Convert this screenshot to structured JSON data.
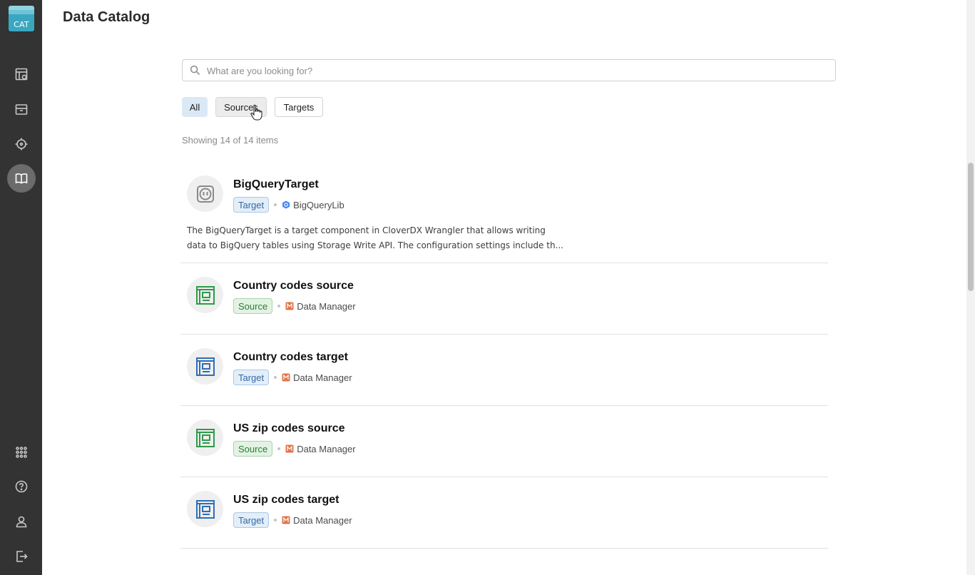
{
  "app": {
    "logo_text": "CAT"
  },
  "sidebar": {
    "items": [
      {
        "name": "sidebar-item-tables",
        "icon": "table-icon",
        "active": false
      },
      {
        "name": "sidebar-item-files",
        "icon": "folder-icon",
        "active": false
      },
      {
        "name": "sidebar-item-target",
        "icon": "crosshair-icon",
        "active": false
      },
      {
        "name": "sidebar-item-catalog",
        "icon": "book-icon",
        "active": true
      }
    ],
    "bottom_items": [
      {
        "name": "sidebar-item-apps",
        "icon": "grid-icon"
      },
      {
        "name": "sidebar-item-help",
        "icon": "help-icon"
      },
      {
        "name": "sidebar-item-profile",
        "icon": "user-icon"
      },
      {
        "name": "sidebar-item-logout",
        "icon": "logout-icon"
      }
    ]
  },
  "header": {
    "title": "Data Catalog"
  },
  "search": {
    "placeholder": "What are you looking for?",
    "value": ""
  },
  "filters": {
    "all": "All",
    "sources": "Sources",
    "targets": "Targets",
    "selected": "All"
  },
  "results": {
    "count_text": "Showing 14 of 14 items"
  },
  "items": [
    {
      "title": "BigQueryTarget",
      "tag": "Target",
      "library": "BigQueryLib",
      "library_icon": "bigquery-icon",
      "description": "The BigQueryTarget is a target component in CloverDX Wrangler that allows writing data to BigQuery tables using Storage Write API. The configuration settings include th..."
    },
    {
      "title": "Country codes source",
      "tag": "Source",
      "library": "Data Manager",
      "library_icon": "data-manager-icon"
    },
    {
      "title": "Country codes target",
      "tag": "Target",
      "library": "Data Manager",
      "library_icon": "data-manager-icon"
    },
    {
      "title": "US zip codes source",
      "tag": "Source",
      "library": "Data Manager",
      "library_icon": "data-manager-icon"
    },
    {
      "title": "US zip codes target",
      "tag": "Target",
      "library": "Data Manager",
      "library_icon": "data-manager-icon"
    }
  ],
  "colors": {
    "sidebar_bg": "#333333",
    "target_tag": "#2f6aa6",
    "source_tag": "#2f7a36",
    "source_icon": "#2e9b4a",
    "target_icon": "#2f6fb5",
    "active_filter_bg": "#dbe9f6"
  }
}
